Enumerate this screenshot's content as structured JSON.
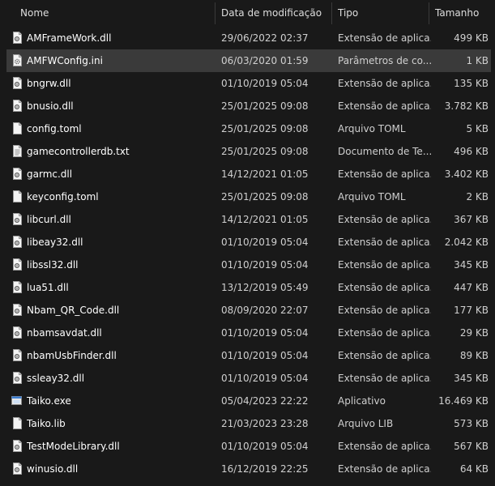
{
  "columns": {
    "name": "Nome",
    "date": "Data de modificação",
    "type": "Tipo",
    "size": "Tamanho"
  },
  "files": [
    {
      "name": "AMFrameWork.dll",
      "date": "29/06/2022 02:37",
      "type": "Extensão de aplica...",
      "size": "499 KB",
      "icon": "dll-file-icon",
      "selected": false
    },
    {
      "name": "AMFWConfig.ini",
      "date": "06/03/2020 01:59",
      "type": "Parâmetros de co...",
      "size": "1 KB",
      "icon": "config-file-icon",
      "selected": true
    },
    {
      "name": "bngrw.dll",
      "date": "01/10/2019 05:04",
      "type": "Extensão de aplica...",
      "size": "135 KB",
      "icon": "dll-file-icon",
      "selected": false
    },
    {
      "name": "bnusio.dll",
      "date": "25/01/2025 09:08",
      "type": "Extensão de aplica...",
      "size": "3.782 KB",
      "icon": "dll-file-icon",
      "selected": false
    },
    {
      "name": "config.toml",
      "date": "25/01/2025 09:08",
      "type": "Arquivo TOML",
      "size": "5 KB",
      "icon": "blank-file-icon",
      "selected": false
    },
    {
      "name": "gamecontrollerdb.txt",
      "date": "25/01/2025 09:08",
      "type": "Documento de Te...",
      "size": "496 KB",
      "icon": "text-file-icon",
      "selected": false
    },
    {
      "name": "garmc.dll",
      "date": "14/12/2021 01:05",
      "type": "Extensão de aplica...",
      "size": "3.402 KB",
      "icon": "dll-file-icon",
      "selected": false
    },
    {
      "name": "keyconfig.toml",
      "date": "25/01/2025 09:08",
      "type": "Arquivo TOML",
      "size": "2 KB",
      "icon": "blank-file-icon",
      "selected": false
    },
    {
      "name": "libcurl.dll",
      "date": "14/12/2021 01:05",
      "type": "Extensão de aplica...",
      "size": "367 KB",
      "icon": "dll-file-icon",
      "selected": false
    },
    {
      "name": "libeay32.dll",
      "date": "01/10/2019 05:04",
      "type": "Extensão de aplica...",
      "size": "2.042 KB",
      "icon": "dll-file-icon",
      "selected": false
    },
    {
      "name": "libssl32.dll",
      "date": "01/10/2019 05:04",
      "type": "Extensão de aplica...",
      "size": "345 KB",
      "icon": "dll-file-icon",
      "selected": false
    },
    {
      "name": "lua51.dll",
      "date": "13/12/2019 05:49",
      "type": "Extensão de aplica...",
      "size": "447 KB",
      "icon": "dll-file-icon",
      "selected": false
    },
    {
      "name": "Nbam_QR_Code.dll",
      "date": "08/09/2020 22:07",
      "type": "Extensão de aplica...",
      "size": "177 KB",
      "icon": "dll-file-icon",
      "selected": false
    },
    {
      "name": "nbamsavdat.dll",
      "date": "01/10/2019 05:04",
      "type": "Extensão de aplica...",
      "size": "29 KB",
      "icon": "dll-file-icon",
      "selected": false
    },
    {
      "name": "nbamUsbFinder.dll",
      "date": "01/10/2019 05:04",
      "type": "Extensão de aplica...",
      "size": "89 KB",
      "icon": "dll-file-icon",
      "selected": false
    },
    {
      "name": "ssleay32.dll",
      "date": "01/10/2019 05:04",
      "type": "Extensão de aplica...",
      "size": "345 KB",
      "icon": "dll-file-icon",
      "selected": false
    },
    {
      "name": "Taiko.exe",
      "date": "05/04/2023 22:22",
      "type": "Aplicativo",
      "size": "16.469 KB",
      "icon": "application-icon",
      "selected": false
    },
    {
      "name": "Taiko.lib",
      "date": "21/03/2023 23:28",
      "type": "Arquivo LIB",
      "size": "573 KB",
      "icon": "blank-file-icon",
      "selected": false
    },
    {
      "name": "TestModeLibrary.dll",
      "date": "01/10/2019 05:04",
      "type": "Extensão de aplica...",
      "size": "567 KB",
      "icon": "dll-file-icon",
      "selected": false
    },
    {
      "name": "winusio.dll",
      "date": "16/12/2019 22:25",
      "type": "Extensão de aplica...",
      "size": "64 KB",
      "icon": "dll-file-icon",
      "selected": false
    }
  ]
}
